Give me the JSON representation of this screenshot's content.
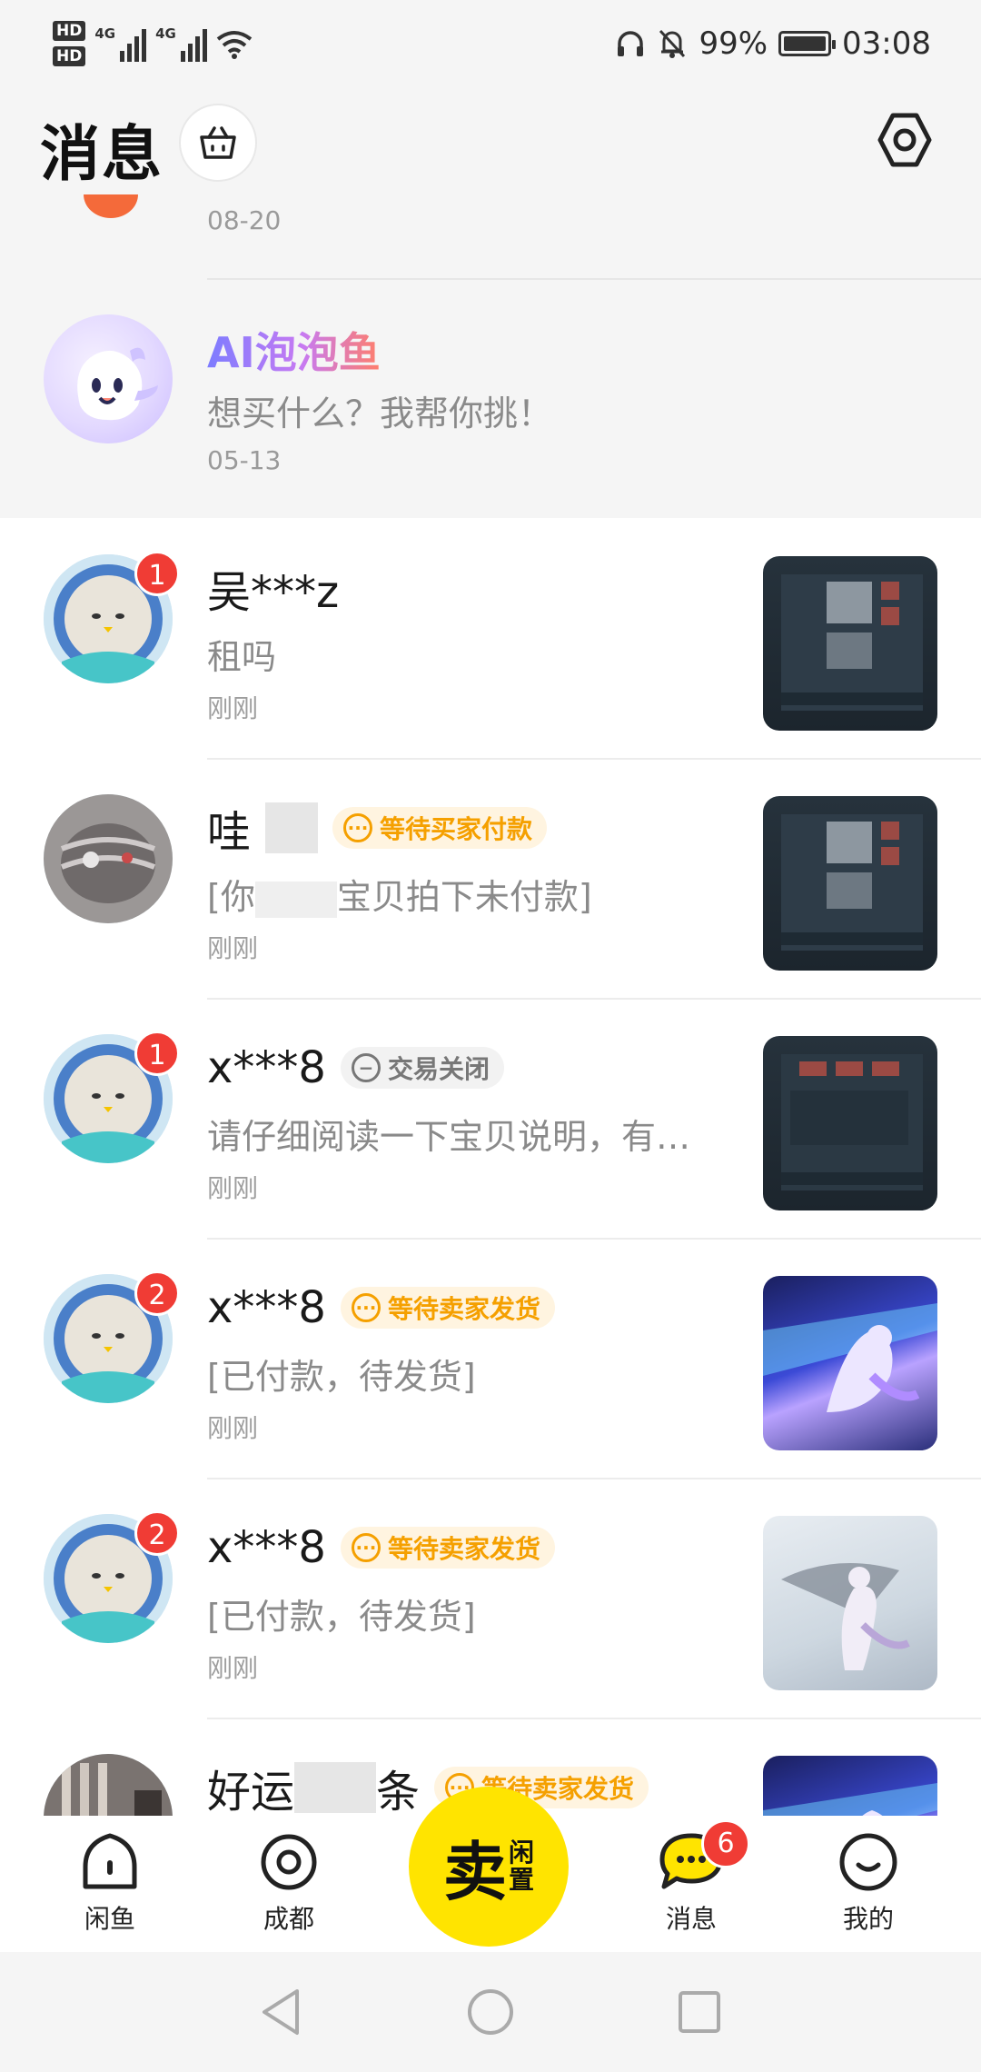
{
  "status_bar": {
    "hd1": "HD",
    "hd2": "HD",
    "net1": "4G",
    "net2": "4G",
    "battery": "99%",
    "time": "03:08"
  },
  "header": {
    "title": "消息"
  },
  "pinned": {
    "top_date": "08-20",
    "ai": {
      "name": "AI泡泡鱼",
      "preview": "想买什么？我帮你挑！",
      "date": "05-13"
    }
  },
  "conversations": [
    {
      "name": "吴***z",
      "unread": "1",
      "tag": "",
      "preview": "租吗",
      "time": "刚刚"
    },
    {
      "name": "哇",
      "unread": "",
      "tag": "等待买家付款",
      "preview": "[你",
      "preview_tail": "宝贝拍下未付款]",
      "time": "刚刚"
    },
    {
      "name": "x***8",
      "unread": "1",
      "tag": "交易关闭",
      "preview": "请仔细阅读一下宝贝说明，有…",
      "time": "刚刚"
    },
    {
      "name": "x***8",
      "unread": "2",
      "tag": "等待卖家发货",
      "preview": "[已付款，待发货]",
      "time": "刚刚"
    },
    {
      "name": "x***8",
      "unread": "2",
      "tag": "等待卖家发货",
      "preview": "[已付款，待发货]",
      "time": "刚刚"
    },
    {
      "name": "好运",
      "name_tail": "条",
      "unread": "",
      "tag": "等待卖家发货",
      "preview": "",
      "time": ""
    }
  ],
  "bottom_nav": {
    "home": "闲鱼",
    "city": "成都",
    "sell_main": "卖",
    "sell_sub1": "闲",
    "sell_sub2": "置",
    "messages": "消息",
    "messages_badge": "6",
    "mine": "我的"
  },
  "colors": {
    "accent_yellow": "#ffe400",
    "badge_red": "#f03c35",
    "pending_orange": "#f5a000"
  }
}
